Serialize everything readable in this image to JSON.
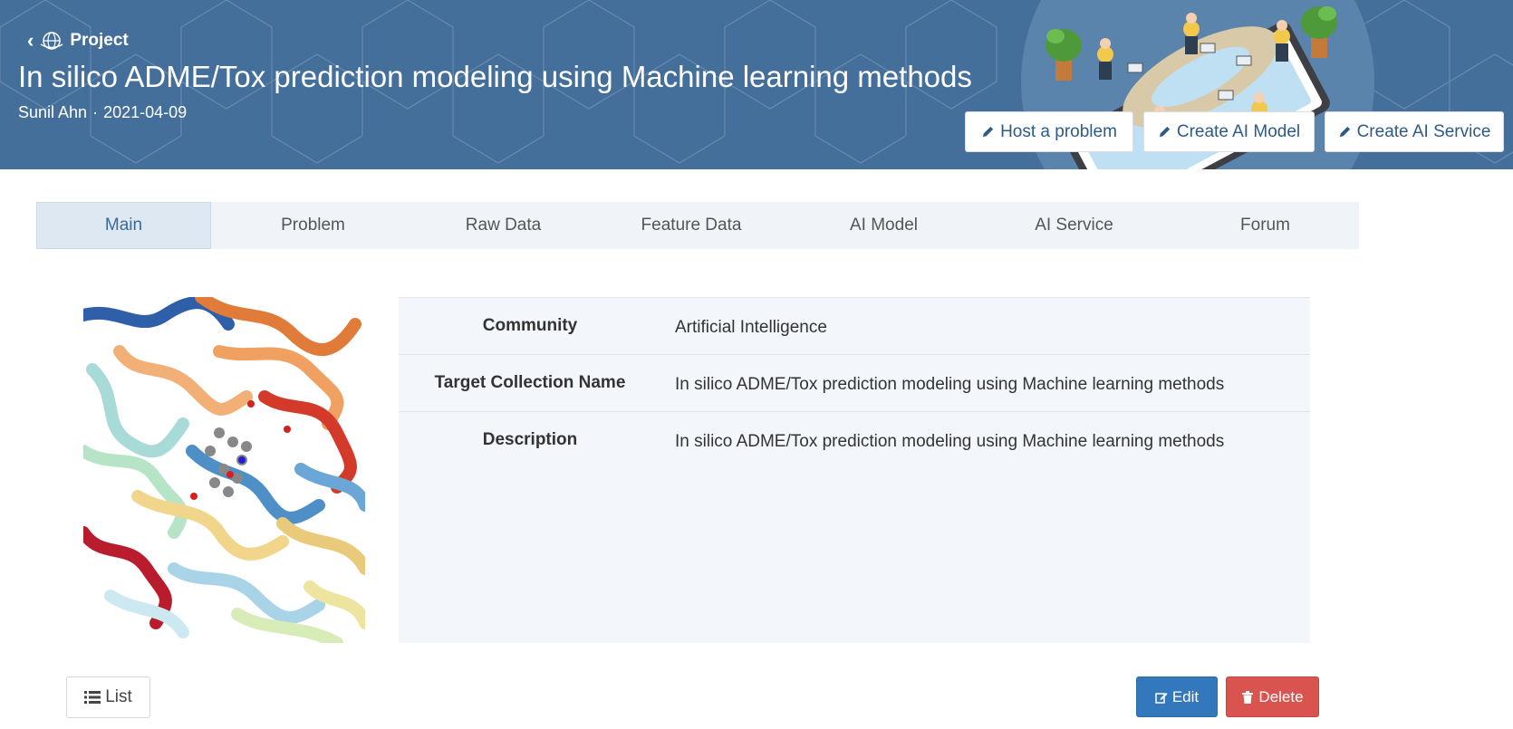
{
  "header": {
    "back_label": "Project",
    "title": "In silico ADME/Tox prediction modeling using Machine learning methods",
    "author": "Sunil Ahn",
    "separator": "·",
    "date": "2021-04-09",
    "buttons": {
      "host_problem": "Host a problem",
      "create_model": "Create AI Model",
      "create_service": "Create AI Service"
    },
    "background_color": "#456f9b"
  },
  "tabs": [
    {
      "label": "Main",
      "active": true
    },
    {
      "label": "Problem"
    },
    {
      "label": "Raw Data"
    },
    {
      "label": "Feature Data"
    },
    {
      "label": "AI Model"
    },
    {
      "label": "AI Service"
    },
    {
      "label": "Forum"
    }
  ],
  "info": {
    "community_label": "Community",
    "community_value": "Artificial Intelligence",
    "target_label": "Target Collection Name",
    "target_value": "In silico ADME/Tox prediction modeling using Machine learning methods",
    "description_label": "Description",
    "description_value": "In silico ADME/Tox prediction modeling using Machine learning methods"
  },
  "footer": {
    "list_label": "List",
    "edit_label": "Edit",
    "delete_label": "Delete",
    "edit_color": "#3378bd",
    "delete_color": "#d9534f"
  },
  "icons": [
    "chevron-left-icon",
    "globe-icon",
    "pencil-icon",
    "list-icon",
    "edit-icon",
    "trash-icon"
  ]
}
